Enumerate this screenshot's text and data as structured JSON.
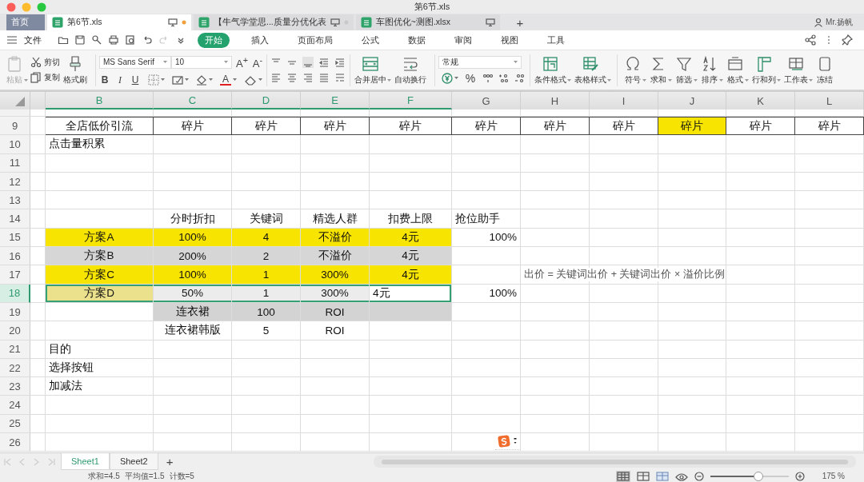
{
  "window": {
    "title": "第6节.xls"
  },
  "tabs": [
    {
      "label": "首页",
      "kind": "home",
      "selected": false
    },
    {
      "label": "第6节.xls",
      "kind": "file",
      "selected": true,
      "modified": true
    },
    {
      "label": "【牛气学堂思...质量分优化表",
      "kind": "file",
      "selected": false,
      "modified": false
    },
    {
      "label": "车图优化~测图.xlsx",
      "kind": "file",
      "selected": false
    }
  ],
  "user": "Mr.扬帆",
  "menu": {
    "file": "文件",
    "ribbon_tabs": [
      {
        "label": "开始",
        "selected": true
      },
      {
        "label": "插入",
        "selected": false
      },
      {
        "label": "页面布局",
        "selected": false
      },
      {
        "label": "公式",
        "selected": false
      },
      {
        "label": "数据",
        "selected": false
      },
      {
        "label": "审阅",
        "selected": false
      },
      {
        "label": "视图",
        "selected": false
      },
      {
        "label": "工具",
        "selected": false
      }
    ]
  },
  "toolbar": {
    "paste": {
      "label": "粘贴",
      "disabled": true
    },
    "cut": "剪切",
    "copy": "复制",
    "format_painter": "格式刷",
    "font": "MS Sans Serif",
    "size": "10",
    "grow": "A$^{+}$",
    "shrink": "A$^{-}$",
    "styles": [
      "B",
      "I",
      "U"
    ],
    "font_color": "A",
    "merge": "合并居中",
    "wrap": "自动换行",
    "number_format": "常规",
    "percent": "%",
    "commands": [
      {
        "label": "条件格式",
        "dropdown": true
      },
      {
        "label": "表格样式",
        "dropdown": true
      },
      {
        "label": "符号",
        "dropdown": true
      },
      {
        "label": "求和",
        "dropdown": true
      },
      {
        "label": "筛选",
        "dropdown": true
      },
      {
        "label": "排序",
        "dropdown": true
      },
      {
        "label": "格式",
        "dropdown": true
      },
      {
        "label": "行和列",
        "dropdown": true
      },
      {
        "label": "工作表",
        "dropdown": true
      },
      {
        "label": "冻结",
        "dropdown": false
      }
    ]
  },
  "sheet": {
    "columns": [
      {
        "label": "B",
        "selected": true
      },
      {
        "label": "C",
        "selected": true
      },
      {
        "label": "D",
        "selected": true
      },
      {
        "label": "E",
        "selected": true
      },
      {
        "label": "F",
        "selected": true
      },
      {
        "label": "G",
        "selected": false
      },
      {
        "label": "H",
        "selected": false
      },
      {
        "label": "I",
        "selected": false
      },
      {
        "label": "J",
        "selected": false
      },
      {
        "label": "K",
        "selected": false
      },
      {
        "label": "L",
        "selected": false
      }
    ],
    "rows": [
      {
        "number": "9",
        "selected": false,
        "boxed": true,
        "cells": [
          {
            "text": "全店低价引流",
            "kind": "center"
          },
          {
            "text": "碎片",
            "kind": "center"
          },
          {
            "text": "碎片",
            "kind": "center"
          },
          {
            "text": "碎片",
            "kind": "center"
          },
          {
            "text": "碎片",
            "kind": "center"
          },
          {
            "text": "碎片",
            "kind": "center"
          },
          {
            "text": "碎片",
            "kind": "center"
          },
          {
            "text": "碎片",
            "kind": "center"
          },
          {
            "text": "碎片",
            "kind": "center",
            "color": "#f7e400"
          },
          {
            "text": "碎片",
            "kind": "center"
          },
          {
            "text": "碎片",
            "kind": "center"
          }
        ]
      },
      {
        "number": "10",
        "selected": false,
        "cells": [
          {
            "text": "点击量积累",
            "kind": "left"
          },
          null,
          null,
          null,
          null,
          null,
          null,
          null,
          null,
          null,
          null
        ]
      },
      {
        "number": "11",
        "selected": false
      },
      {
        "number": "12",
        "selected": false
      },
      {
        "number": "13",
        "selected": false
      },
      {
        "number": "14",
        "selected": false,
        "cells": [
          null,
          {
            "text": "分时折扣",
            "kind": "center"
          },
          {
            "text": "关键词",
            "kind": "center"
          },
          {
            "text": "精选人群",
            "kind": "center"
          },
          {
            "text": "扣费上限",
            "kind": "center"
          },
          {
            "text": "抢位助手",
            "kind": "left"
          },
          null,
          null,
          null,
          null,
          null
        ]
      },
      {
        "number": "15",
        "selected": false,
        "cells": [
          {
            "text": "方案A",
            "kind": "center",
            "color": "#f7e400"
          },
          {
            "text": "100%",
            "kind": "center",
            "color": "#f7e400"
          },
          {
            "text": "4",
            "kind": "center",
            "color": "#f7e400"
          },
          {
            "text": "不溢价",
            "kind": "center",
            "color": "#f7e400"
          },
          {
            "text": "4元",
            "kind": "center",
            "color": "#f7e400"
          },
          {
            "text": "100%",
            "kind": "right"
          },
          null,
          null,
          null,
          null,
          null
        ]
      },
      {
        "number": "16",
        "selected": false,
        "cells": [
          {
            "text": "方案B",
            "kind": "center",
            "color": "#d6d6d6"
          },
          {
            "text": "200%",
            "kind": "center",
            "color": "#d6d6d6"
          },
          {
            "text": "2",
            "kind": "center",
            "color": "#d6d6d6"
          },
          {
            "text": "不溢价",
            "kind": "center",
            "color": "#d6d6d6"
          },
          {
            "text": "4元",
            "kind": "center",
            "color": "#d6d6d6"
          },
          null,
          null,
          null,
          null,
          null,
          null
        ]
      },
      {
        "number": "17",
        "selected": false,
        "cells": [
          {
            "text": "方案C",
            "kind": "center",
            "color": "#f7e400"
          },
          {
            "text": "100%",
            "kind": "center",
            "color": "#f7e400"
          },
          {
            "text": "1",
            "kind": "center",
            "color": "#f7e400"
          },
          {
            "text": "300%",
            "kind": "center",
            "color": "#f7e400"
          },
          {
            "text": "4元",
            "kind": "center",
            "color": "#f7e400"
          },
          null,
          {
            "text": "出价 = 关键词出价 + 关键词出价 × 溢价比例",
            "kind": "left"
          },
          null,
          null,
          null,
          null
        ]
      },
      {
        "number": "18",
        "selected": true,
        "cells": [
          {
            "text": "方案D",
            "kind": "center",
            "color": "#ebe08c"
          },
          {
            "text": "50%",
            "kind": "center",
            "color": "#ececec"
          },
          {
            "text": "1",
            "kind": "center",
            "color": "#ececec"
          },
          {
            "text": "300%",
            "kind": "center",
            "color": "#ececec"
          },
          {
            "text": "4元",
            "kind": "left"
          },
          {
            "text": "100%",
            "kind": "right"
          },
          null,
          null,
          null,
          null,
          null
        ]
      },
      {
        "number": "19",
        "selected": false,
        "cells": [
          null,
          {
            "text": "连衣裙",
            "kind": "center",
            "color": "#d3d3d3"
          },
          {
            "text": "100",
            "kind": "center",
            "color": "#d3d3d3"
          },
          {
            "text": "ROI",
            "kind": "center",
            "color": "#d3d3d3"
          },
          {
            "color": "#d3d3d3"
          },
          null,
          null,
          null,
          null,
          null,
          null
        ]
      },
      {
        "number": "20",
        "selected": false,
        "cells": [
          null,
          {
            "text": "连衣裙韩版",
            "kind": "center"
          },
          {
            "text": "5",
            "kind": "center"
          },
          {
            "text": "ROI",
            "kind": "center"
          },
          null,
          null,
          null,
          null,
          null,
          null,
          null
        ]
      },
      {
        "number": "21",
        "selected": false,
        "cells": [
          {
            "text": "目的",
            "kind": "left"
          },
          null,
          null,
          null,
          null,
          null,
          null,
          null,
          null,
          null,
          null
        ]
      },
      {
        "number": "22",
        "selected": false,
        "cells": [
          {
            "text": "选择按钮",
            "kind": "left"
          },
          null,
          null,
          null,
          null,
          null,
          null,
          null,
          null,
          null,
          null
        ]
      },
      {
        "number": "23",
        "selected": false,
        "cells": [
          {
            "text": "加减法",
            "kind": "left"
          },
          null,
          null,
          null,
          null,
          null,
          null,
          null,
          null,
          null,
          null
        ]
      },
      {
        "number": "24",
        "selected": false
      },
      {
        "number": "25",
        "selected": false
      },
      {
        "number": "26",
        "selected": false
      }
    ]
  },
  "sheet_tabs": [
    {
      "label": "Sheet1",
      "selected": true
    },
    {
      "label": "Sheet2",
      "selected": false
    }
  ],
  "add_sheet": "+",
  "new_tab": "+",
  "status_bar": {
    "stats": [
      "求和=4.5",
      "平均值=1.5",
      "计数=5"
    ],
    "zoom": {
      "level": 0.62,
      "reading": "175 %"
    }
  }
}
